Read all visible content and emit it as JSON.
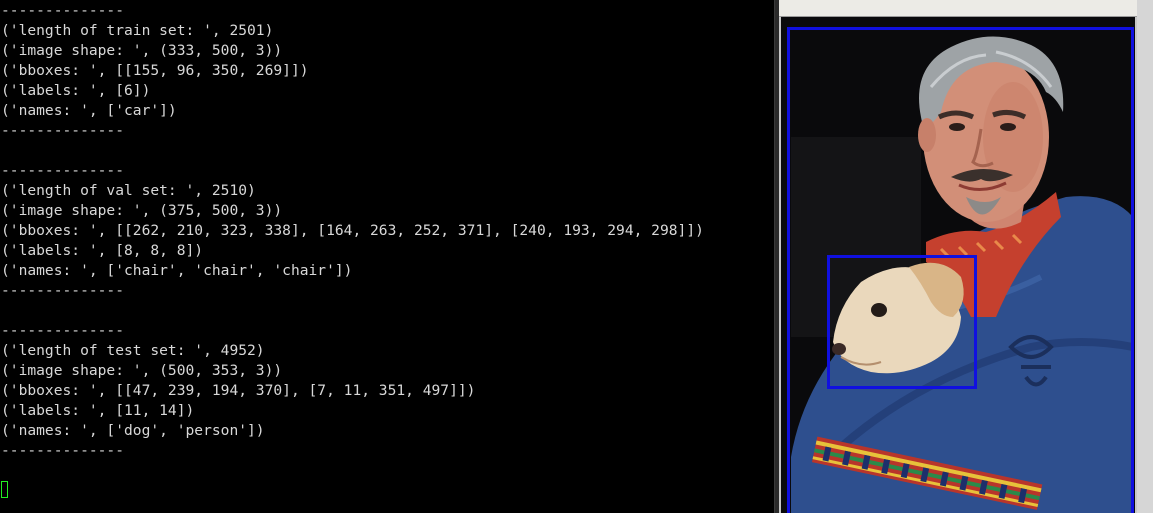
{
  "terminal": {
    "lines": [
      "--------------",
      "('length of train set: ', 2501)",
      "('image shape: ', (333, 500, 3))",
      "('bboxes: ', [[155, 96, 350, 269]])",
      "('labels: ', [6])",
      "('names: ', ['car'])",
      "--------------",
      "",
      "--------------",
      "('length of val set: ', 2510)",
      "('image shape: ', (375, 500, 3))",
      "('bboxes: ', [[262, 210, 323, 338], [164, 263, 252, 371], [240, 193, 294, 298]])",
      "('labels: ', [8, 8, 8])",
      "('names: ', ['chair', 'chair', 'chair'])",
      "--------------",
      "",
      "--------------",
      "('length of test set: ', 4952)",
      "('image shape: ', (500, 353, 3))",
      "('bboxes: ', [[47, 239, 194, 370], [7, 11, 351, 497]])",
      "('labels: ', [11, 14])",
      "('names: ', ['dog', 'person'])",
      "--------------"
    ],
    "text_color": "#d8d8d8",
    "background": "#000000",
    "cursor_color": "#22ee22"
  },
  "viewer": {
    "bbox_color": "#1010e0",
    "image_subject": "man holding a dog with bounding boxes drawn"
  }
}
